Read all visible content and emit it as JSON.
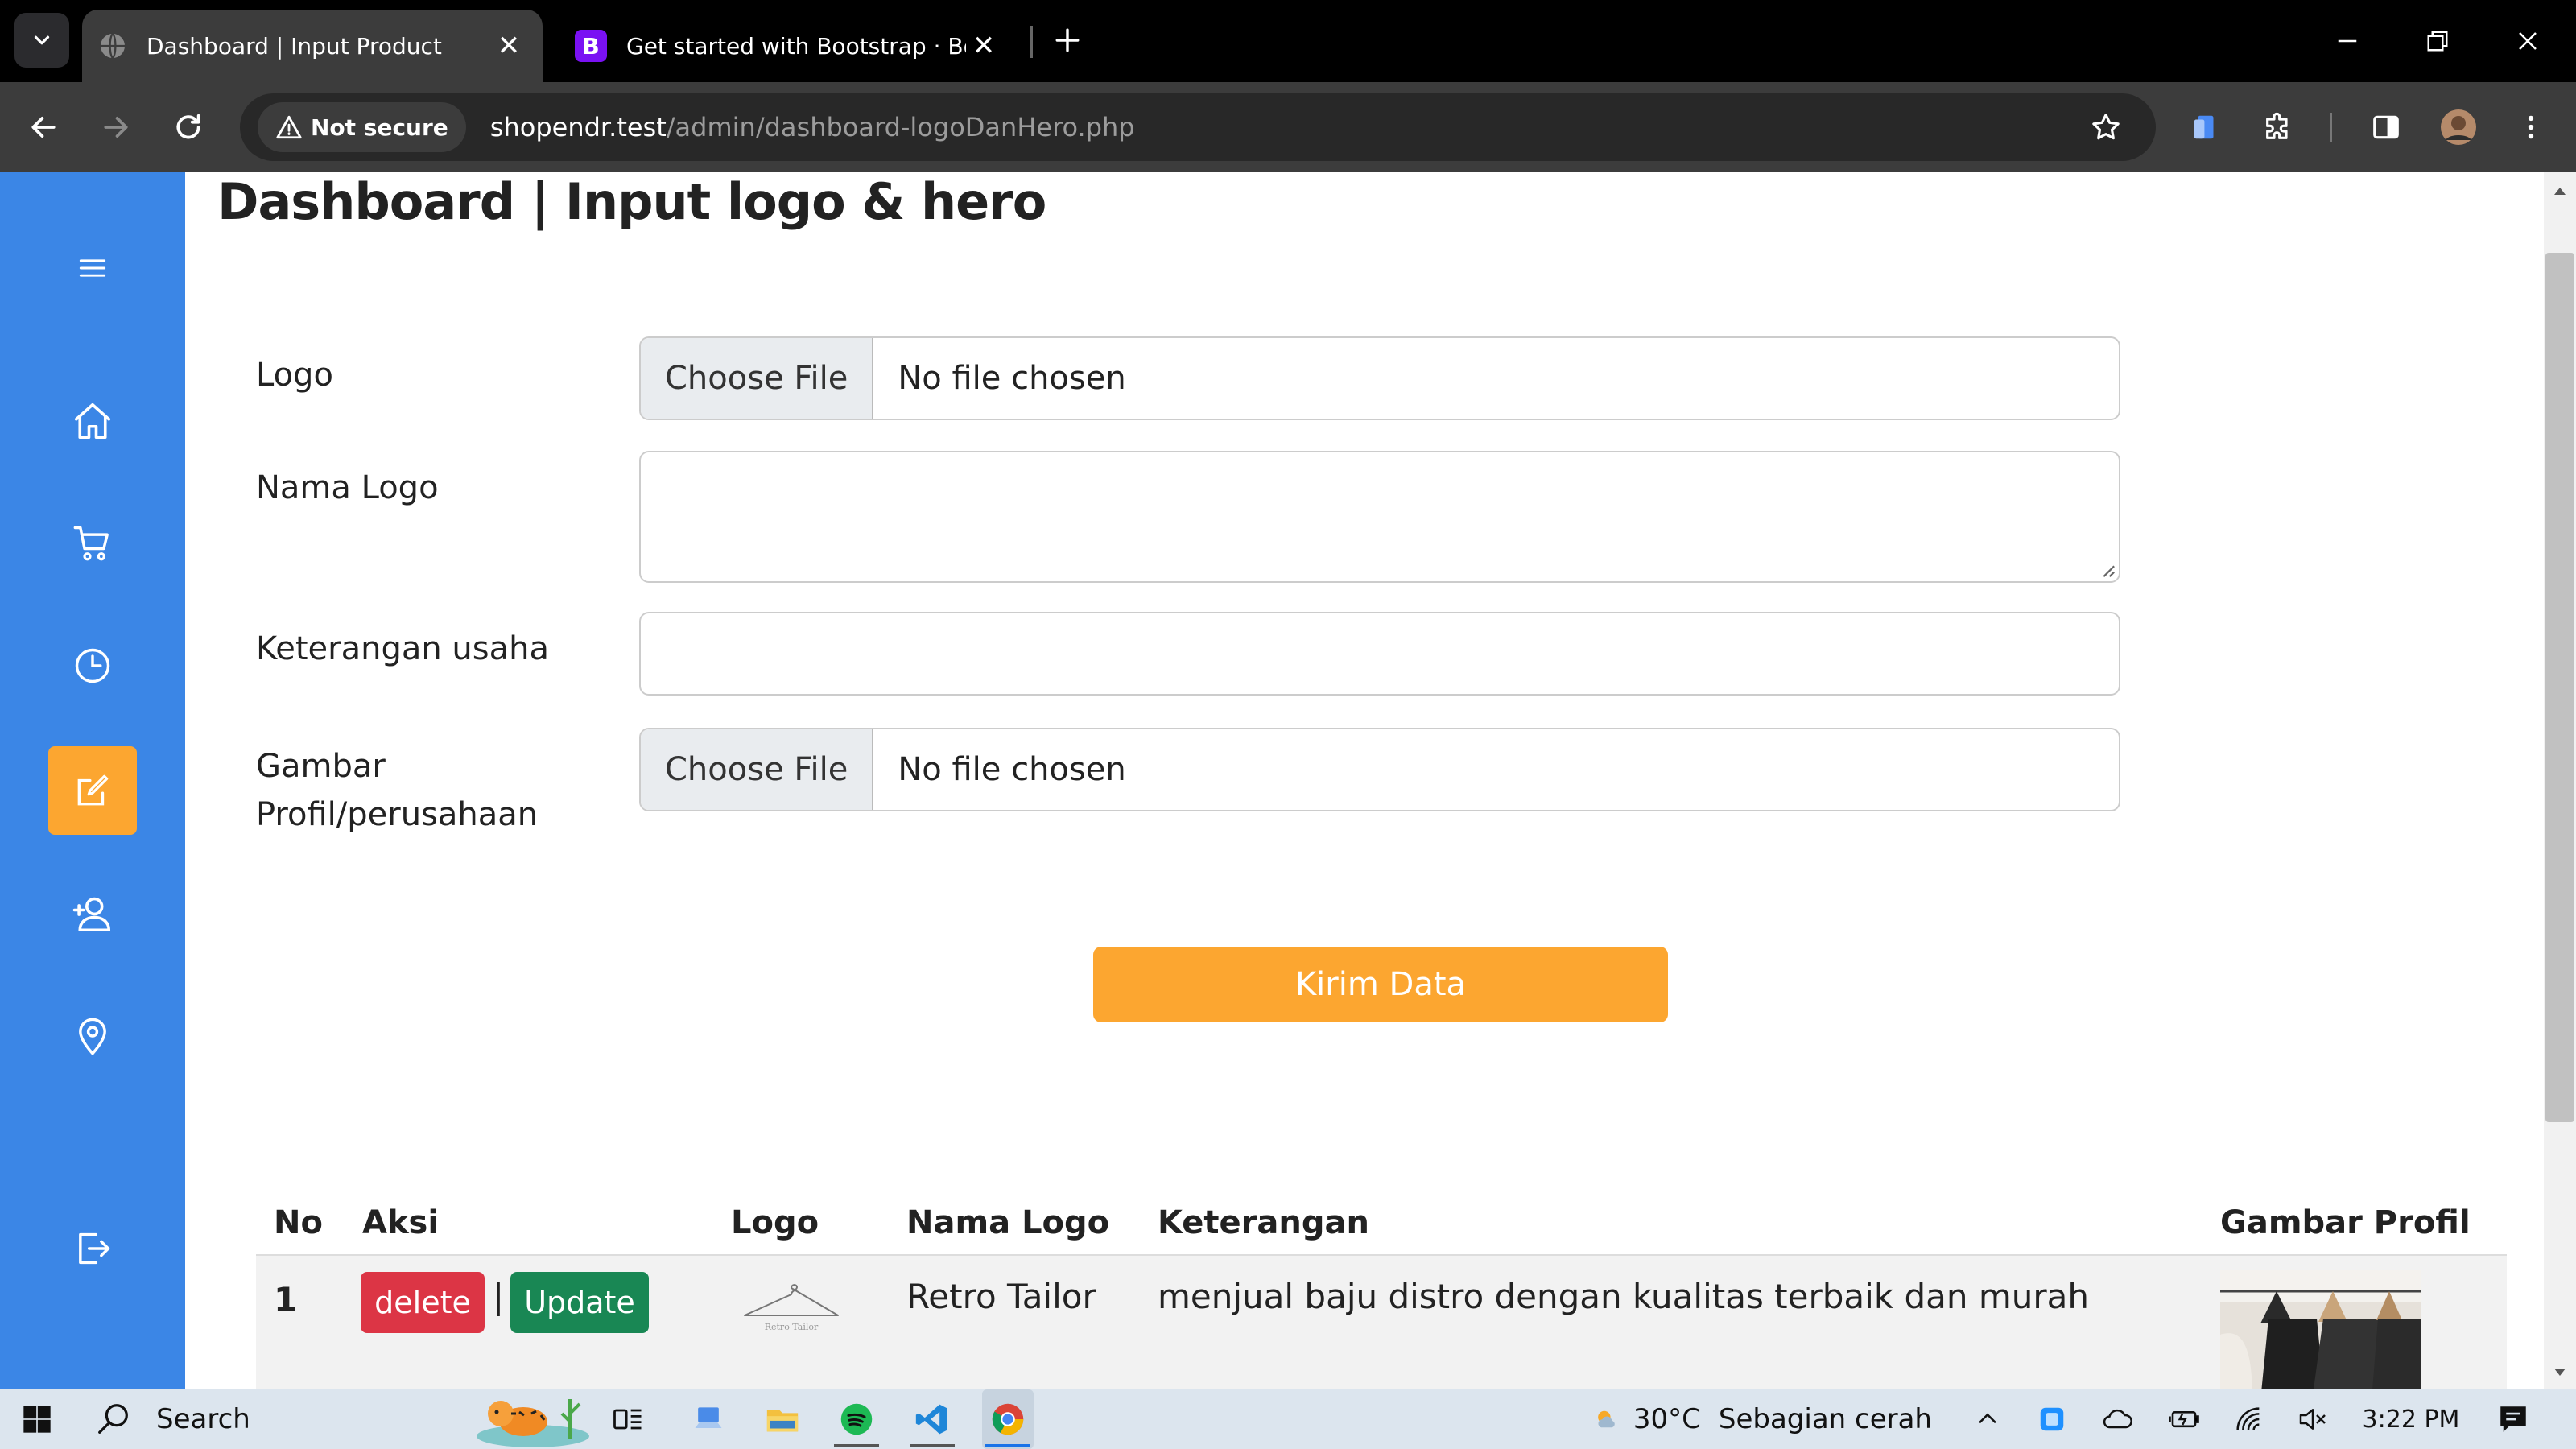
{
  "browser": {
    "tabs": [
      {
        "title": "Dashboard | Input Product",
        "favicon": "globe-icon",
        "active": true
      },
      {
        "title": "Get started with Bootstrap · Boo",
        "favicon": "bootstrap-icon",
        "favicon_letter": "B",
        "active": false
      }
    ],
    "security_label": "Not secure",
    "url_host": "shopendr.test",
    "url_path": "/admin/dashboard-logoDanHero.php"
  },
  "sidebar": {
    "items": [
      {
        "icon": "menu-icon"
      },
      {
        "icon": "home-icon"
      },
      {
        "icon": "cart-icon"
      },
      {
        "icon": "clock-icon"
      },
      {
        "icon": "edit-icon",
        "active": true
      },
      {
        "icon": "user-add-icon"
      },
      {
        "icon": "location-icon"
      },
      {
        "icon": "logout-icon"
      }
    ],
    "color": "#3b86e6",
    "active_color": "#fca630"
  },
  "page": {
    "title": "Dashboard | Input logo & hero"
  },
  "form": {
    "logo_label": "Logo",
    "nama_logo_label": "Nama Logo",
    "keterangan_label": "Keterangan usaha",
    "gambar_label_line1": "Gambar",
    "gambar_label_line2": "Profil/perusahaan",
    "file_button": "Choose File",
    "file_status": "No file chosen",
    "nama_logo_value": "",
    "keterangan_value": "",
    "submit_label": "Kirim Data"
  },
  "table": {
    "headers": [
      "No",
      "Aksi",
      "Logo",
      "Nama Logo",
      "Keterangan",
      "Gambar Profil"
    ],
    "rows": [
      {
        "no": "1",
        "delete_label": "delete",
        "separator": "|",
        "update_label": "Update",
        "logo_caption": "Retro Tailor",
        "nama_logo": "Retro Tailor",
        "keterangan": "menjual baju distro dengan kualitas terbaik dan murah"
      }
    ]
  },
  "taskbar": {
    "search_label": "Search",
    "weather_temp": "30°C",
    "weather_desc": "Sebagian cerah",
    "time": "3:22 PM"
  },
  "colors": {
    "accent": "#fca630",
    "delete": "#dc3545",
    "update": "#198754"
  }
}
